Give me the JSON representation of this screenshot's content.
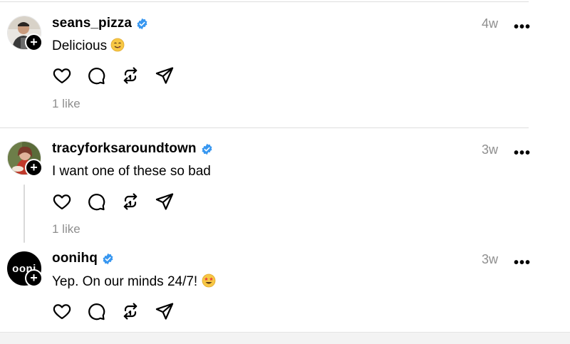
{
  "posts": [
    {
      "username": "seans_pizza",
      "verified": true,
      "time": "4w",
      "text": "Delicious",
      "emoji": "yum-emoji",
      "likes": "1 like"
    },
    {
      "username": "tracyforksaroundtown",
      "verified": true,
      "time": "3w",
      "text": "I want one of these so bad",
      "likes": "1 like"
    },
    {
      "username": "oonihq",
      "verified": true,
      "time": "3w",
      "text": "Yep. On our minds 24/7!",
      "emoji": "star-struck-emoji",
      "avatar_text": "ooni"
    }
  ],
  "more_label": "•••",
  "follow_plus": "+",
  "icons": [
    "heart-icon",
    "comment-icon",
    "repost-icon",
    "share-icon"
  ],
  "colors": {
    "verified": "#3897f0",
    "muted": "#8e8e8e",
    "divider": "#dedede"
  }
}
